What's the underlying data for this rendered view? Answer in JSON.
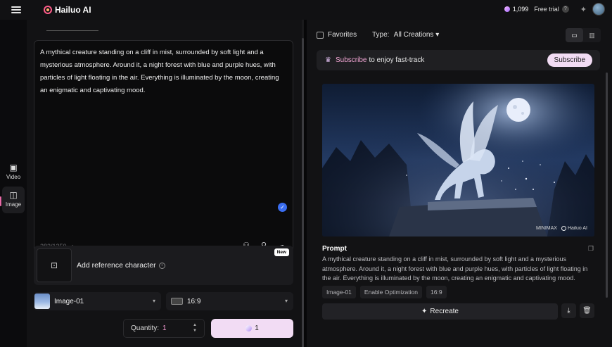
{
  "app": {
    "logo_text": "Hailuo AI"
  },
  "topbar": {
    "credits": "1,099",
    "free_trial_label": "Free trial"
  },
  "rail": {
    "video_label": "Video",
    "image_label": "Image"
  },
  "left": {
    "prompt_text": "A mythical creature standing on a cliff in mist, surrounded by soft light and a mysterious atmosphere. Around it, a night forest with blue and purple hues, with particles of light floating in the air. Everything is illuminated by the moon, creating an enigmatic and captivating mood.",
    "char_count": "283/1250",
    "reference": {
      "label": "Add reference character",
      "badge": "New"
    },
    "model": "Image-01",
    "ratio": "16:9",
    "quantity_label": "Quantity:",
    "quantity_value": "1",
    "generate_cost": "1"
  },
  "right": {
    "favorites_label": "Favorites",
    "type_label": "Type:",
    "type_value": "All Creations",
    "subscribe": {
      "highlight": "Subscribe",
      "text": "to enjoy fast-track",
      "button": "Subscribe"
    },
    "card": {
      "watermark_minimax": "MINIMAX",
      "watermark_hailuo": "Hailuo AI",
      "prompt_heading": "Prompt",
      "prompt_body": "A mythical creature standing on a cliff in mist, surrounded by soft light and a mysterious atmosphere. Around it, a night forest with blue and purple hues, with particles of light floating in the air. Everything is illuminated by the moon, creating an enigmatic and captivating mood.",
      "tags": [
        "Image-01",
        "Enable Optimization",
        "16:9"
      ],
      "recreate_label": "Recreate"
    }
  },
  "colors": {
    "accent_pink": "#f2dcf4",
    "check_blue": "#3a6df0"
  }
}
